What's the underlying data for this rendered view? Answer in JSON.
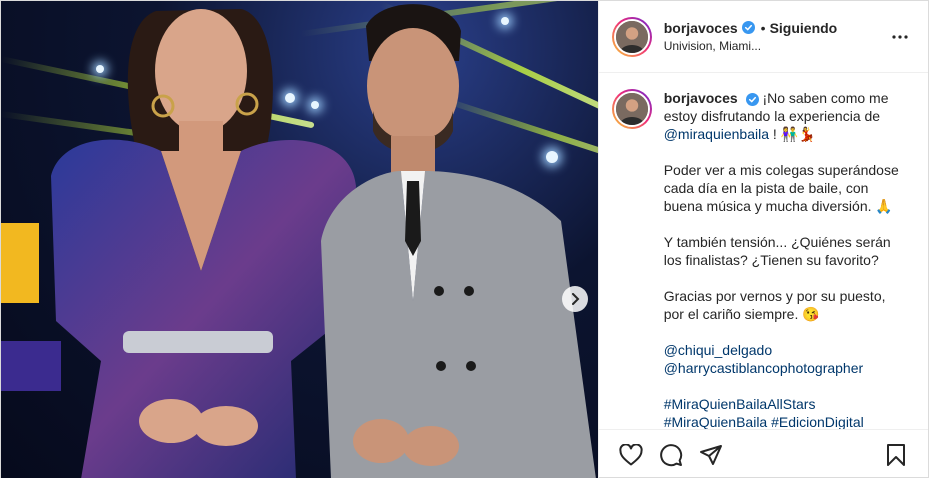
{
  "post": {
    "author": {
      "username": "borjavoces",
      "verified": true,
      "follow_status": "Siguiendo",
      "location": "Univision, Miami..."
    },
    "caption": {
      "username": "borjavoces",
      "p1_text": "¡No saben como me estoy disfrutando la experiencia de",
      "p1_mention": "@miraquienbaila",
      "p1_tail": "!",
      "p1_emoji": "👫💃",
      "p2_text": "Poder ver a mis colegas superándose cada día en la pista de baile, con buena música y mucha diversión.",
      "p2_emoji": "🙏",
      "p3_text": "Y también tensión... ¿Quiénes serán los finalistas? ¿Tienen su favorito?",
      "p4_text": "Gracias por vernos y por su puesto, por el cariño siempre.",
      "p4_emoji": "😘",
      "mentions": [
        "@chiqui_delgado",
        "@harrycastiblancophotographer"
      ],
      "hashtags_line1": "#MiraQuienBailaAllStars",
      "hashtags_line2": "#MiraQuienBaila #EdicionDigital"
    },
    "icons": {
      "verified": "verified-badge-icon",
      "more": "more-options-icon",
      "like": "heart-icon",
      "comment": "comment-icon",
      "share": "paper-plane-icon",
      "save": "bookmark-icon",
      "carousel_next": "chevron-right-icon"
    },
    "colors": {
      "link": "#00376b",
      "verified": "#3897f0",
      "text": "#262626"
    }
  }
}
